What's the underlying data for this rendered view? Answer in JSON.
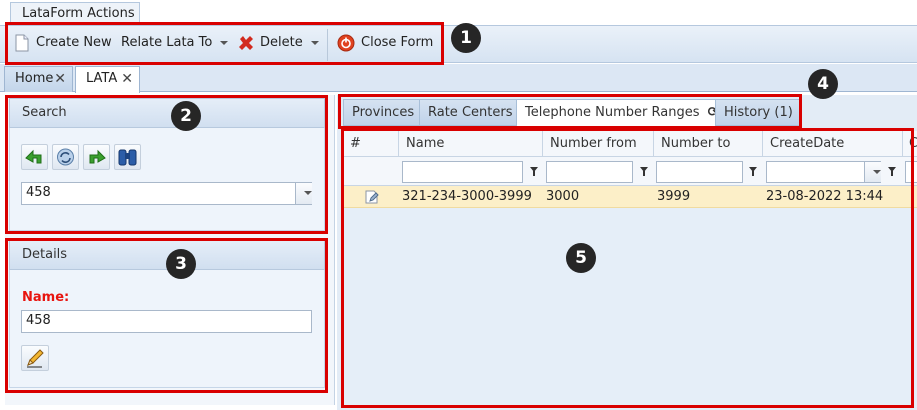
{
  "ribbon": {
    "tab_label": "LataForm Actions",
    "buttons": {
      "create_new": "Create New",
      "relate_lata": "Relate Lata To",
      "delete": "Delete",
      "close_form": "Close Form"
    }
  },
  "form_tabs": [
    {
      "label": "Home",
      "active": false
    },
    {
      "label": "LATA",
      "active": true
    }
  ],
  "search": {
    "title": "Search",
    "buttons": [
      "back-arrow-icon",
      "refresh-icon",
      "forward-arrow-icon",
      "binoculars-icon"
    ],
    "value": "458"
  },
  "details": {
    "title": "Details",
    "name_label": "Name:",
    "name_value": "458"
  },
  "right_tabs": [
    {
      "label": "Provinces",
      "active": false
    },
    {
      "label": "Rate Centers",
      "active": false
    },
    {
      "label": "Telephone Number Ranges",
      "active": true
    },
    {
      "label": "History (1)",
      "active": false
    }
  ],
  "grid": {
    "columns": [
      "#",
      "Name",
      "Number from",
      "Number to",
      "CreateDate",
      "C"
    ],
    "rows": [
      {
        "name": "321-234-3000-3999",
        "number_from": "3000",
        "number_to": "3999",
        "create_date": "23-08-2022 13:44"
      }
    ]
  },
  "annotations": [
    "1",
    "2",
    "3",
    "4",
    "5"
  ],
  "colors": {
    "annotation_red": "#d90000",
    "selected_row": "#fcefc8",
    "label_red": "#e8140f"
  }
}
